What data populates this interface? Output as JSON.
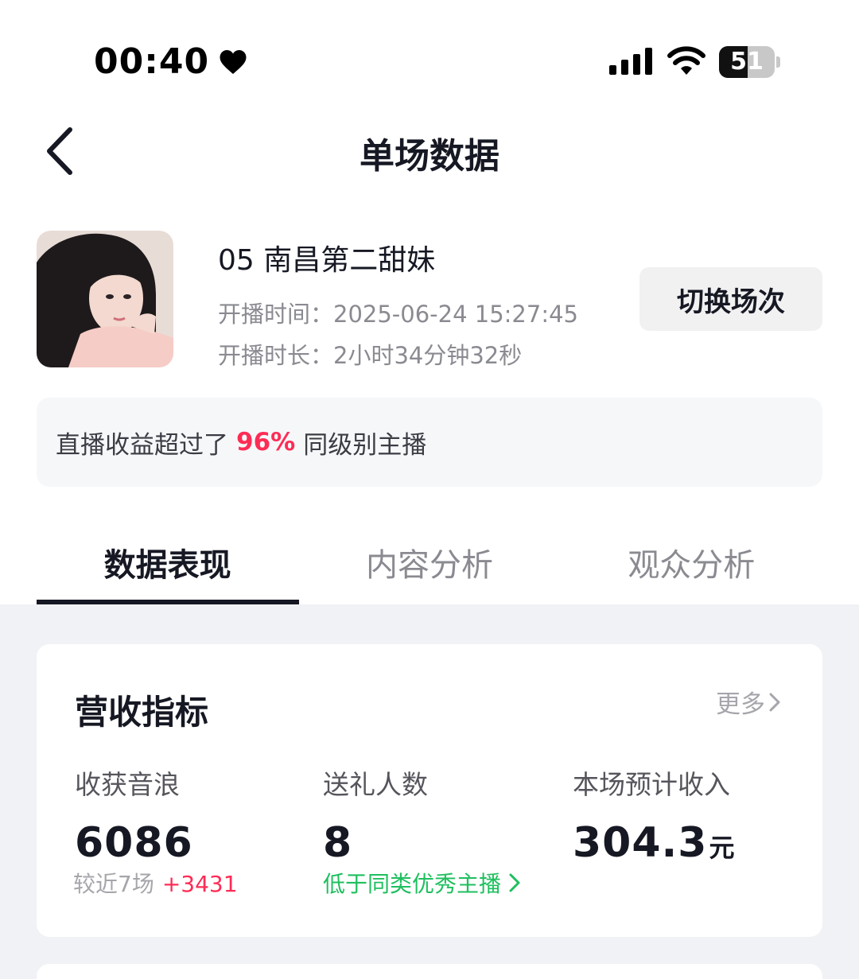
{
  "status_bar": {
    "time": "00:40",
    "battery": "51",
    "battery_level": 0.51
  },
  "nav": {
    "title": "单场数据"
  },
  "host": {
    "name": "05 南昌第二甜妹",
    "start_time": "开播时间：2025-06-24 15:27:45",
    "duration": "开播时长：2小时34分钟32秒",
    "switch_label": "切换场次"
  },
  "banner": {
    "prefix": "直播收益超过了",
    "percent": "96%",
    "suffix": "同级别主播"
  },
  "tabs": [
    {
      "label": "数据表现",
      "active": true
    },
    {
      "label": "内容分析",
      "active": false
    },
    {
      "label": "观众分析",
      "active": false
    }
  ],
  "revenue_card": {
    "title": "营收指标",
    "more": "更多",
    "metrics": [
      {
        "label": "收获音浪",
        "value": "6086",
        "sub_label": "较近7场",
        "sub_delta": "+3431"
      },
      {
        "label": "送礼人数",
        "value": "8",
        "sub_link": "低于同类优秀主播"
      },
      {
        "label": "本场预计收入",
        "value": "304.3",
        "unit": "元"
      }
    ]
  },
  "colors": {
    "accent_red": "#fe2c55",
    "accent_green": "#1fbf5f",
    "text_primary": "#161823"
  }
}
